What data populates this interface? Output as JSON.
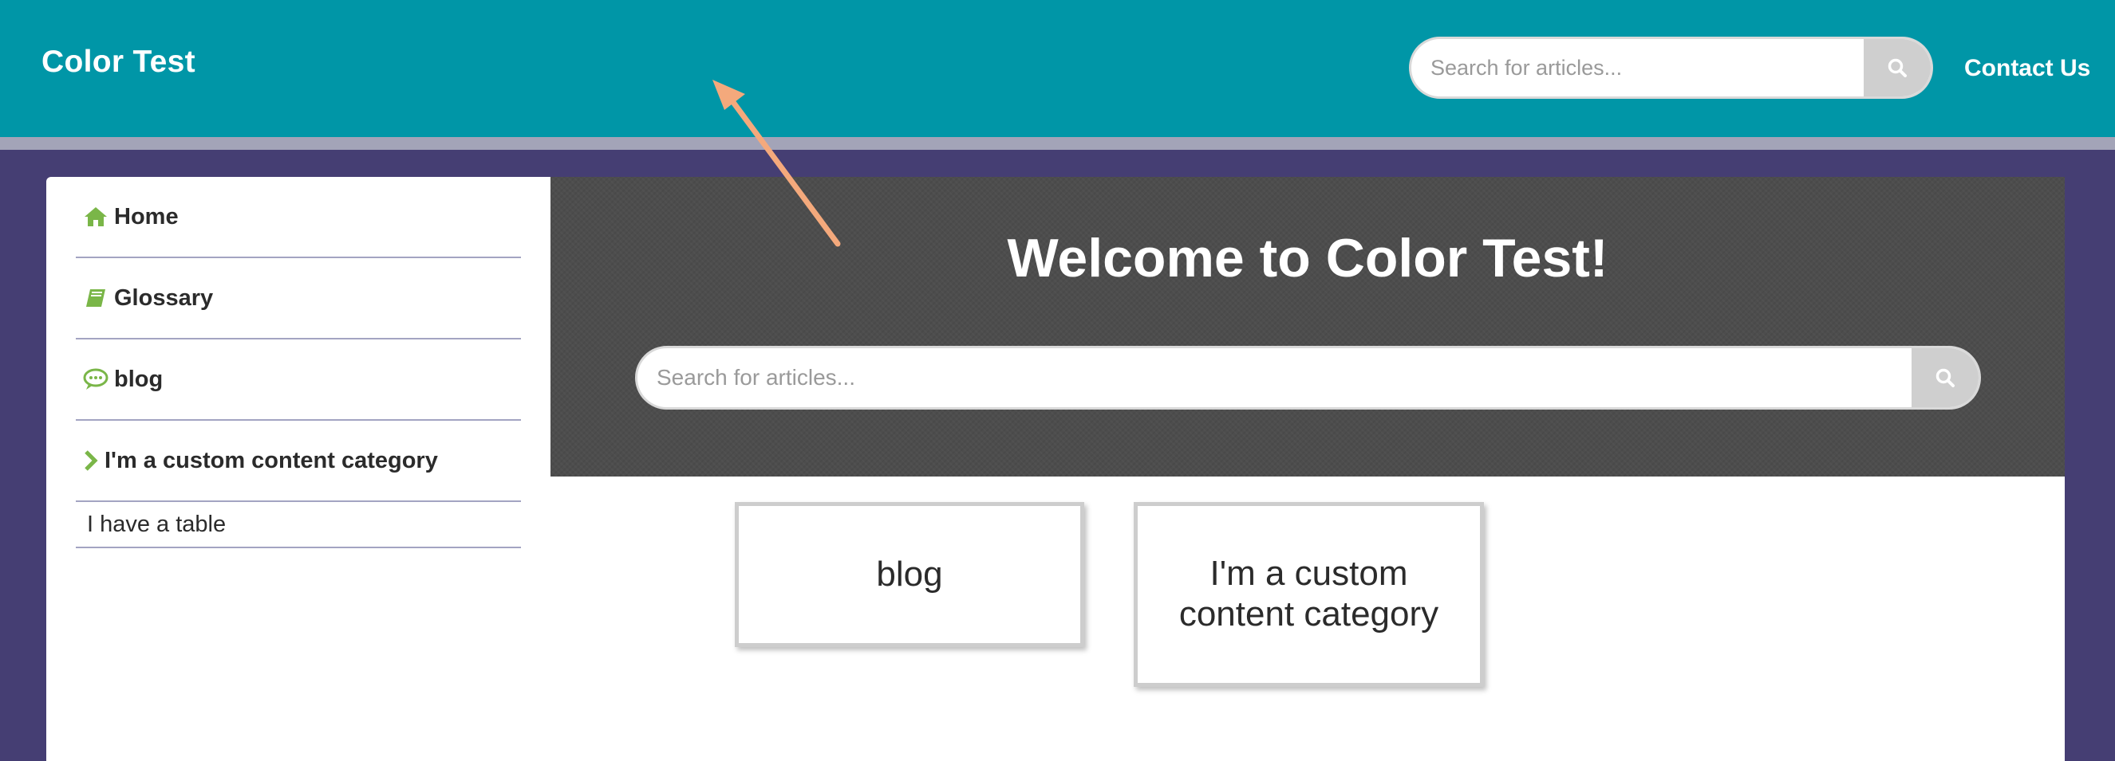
{
  "header": {
    "site_title": "Color Test",
    "search_placeholder": "Search for articles...",
    "contact_label": "Contact Us"
  },
  "sidebar": {
    "items": [
      {
        "label": "Home",
        "icon": "home-icon"
      },
      {
        "label": "Glossary",
        "icon": "book-icon"
      },
      {
        "label": "blog",
        "icon": "speech-bubble-icon"
      },
      {
        "label": "I'm a custom content category",
        "icon": "chevron-right-icon"
      }
    ],
    "sub_items": [
      {
        "label": "I have a table"
      }
    ]
  },
  "hero": {
    "title": "Welcome to Color Test!",
    "search_placeholder": "Search for articles..."
  },
  "categories": [
    {
      "label": "blog"
    },
    {
      "label": "I'm a custom content category"
    }
  ],
  "colors": {
    "header_bg": "#0096a7",
    "page_bg": "#453e73",
    "hero_bg": "#4d4d4d",
    "icon_green": "#7ab648",
    "annotation_arrow": "#f4a97c"
  }
}
